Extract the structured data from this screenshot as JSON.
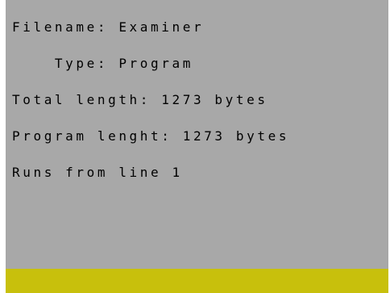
{
  "screen": {
    "lines": [
      "Filename: Examiner",
      "    Type: Program",
      "Total length: 1273 bytes",
      "Program lenght: 1273 bytes",
      "Runs from line 1"
    ],
    "colors": {
      "paper": "#a8a8a8",
      "ink": "#000000",
      "border": "#c8c00c",
      "margin": "#ffffff"
    }
  }
}
